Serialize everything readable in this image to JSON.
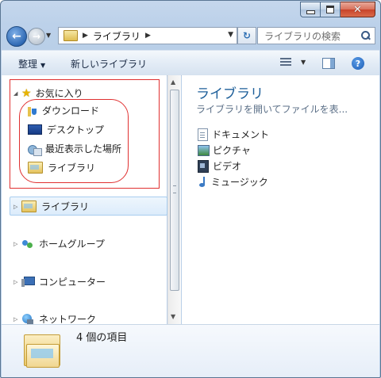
{
  "window": {
    "minimize_glyph": "‒",
    "close_glyph": "✕"
  },
  "navigation": {
    "address_crumbs": [
      "ライブラリ"
    ],
    "search_placeholder": "ライブラリの検索"
  },
  "toolbar": {
    "organize_label": "整理",
    "new_library_label": "新しいライブラリ"
  },
  "nav_pane": {
    "favorites_label": "お気に入り",
    "favorites_items": [
      {
        "label": "ダウンロード",
        "icon": "download-folder-icon"
      },
      {
        "label": "デスクトップ",
        "icon": "desktop-icon"
      },
      {
        "label": "最近表示した場所",
        "icon": "recent-places-icon"
      },
      {
        "label": "ライブラリ",
        "icon": "library-icon"
      }
    ],
    "groups": [
      {
        "label": "ライブラリ",
        "icon": "library-icon",
        "selected": true
      },
      {
        "label": "ホームグループ",
        "icon": "homegroup-icon"
      },
      {
        "label": "コンピューター",
        "icon": "computer-icon"
      },
      {
        "label": "ネットワーク",
        "icon": "network-icon"
      }
    ]
  },
  "content": {
    "title": "ライブラリ",
    "subtitle": "ライブラリを開いてファイルを表...",
    "items": [
      {
        "label": "ドキュメント",
        "icon": "documents-icon"
      },
      {
        "label": "ピクチャ",
        "icon": "pictures-icon"
      },
      {
        "label": "ビデオ",
        "icon": "videos-icon"
      },
      {
        "label": "ミュージック",
        "icon": "music-icon"
      }
    ]
  },
  "details": {
    "item_count_text": "4 個の項目"
  },
  "colors": {
    "title_text": "#1c5e99",
    "annotation_red": "#e03030"
  }
}
